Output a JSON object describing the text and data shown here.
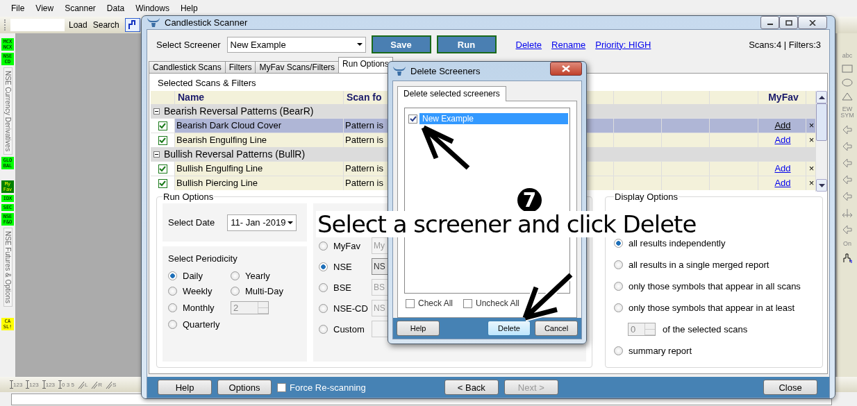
{
  "menu": [
    "File",
    "View",
    "Scanner",
    "Data",
    "Windows",
    "Help"
  ],
  "toolbar": {
    "buttons": [
      "Load",
      "Search"
    ]
  },
  "left_strip": [
    {
      "kind": "tag",
      "lines": [
        "MCX",
        "NCX"
      ],
      "color": "#00ff00"
    },
    {
      "kind": "tag",
      "lines": [
        "NSE",
        "CD"
      ],
      "color": "#00ff00"
    },
    {
      "kind": "vertical",
      "label": "NSE Currency Derivatives"
    },
    {
      "kind": "tag",
      "lines": [
        "GLO",
        "BAL"
      ],
      "color": "#00ff00"
    },
    {
      "kind": "gap"
    },
    {
      "kind": "tag",
      "lines": [
        "My",
        "Fav"
      ],
      "color": "#008000"
    },
    {
      "kind": "tag",
      "lines": [
        "IDX"
      ],
      "color": "#00ff00"
    },
    {
      "kind": "tag",
      "lines": [
        "SEC"
      ],
      "color": "#00ff00"
    },
    {
      "kind": "tag",
      "lines": [
        "NSE",
        "F&O"
      ],
      "color": "#00ff00"
    },
    {
      "kind": "vertical",
      "label": "NSE Futures & Options"
    },
    {
      "kind": "gap"
    },
    {
      "kind": "tag",
      "lines": [
        "CA",
        "SL!"
      ],
      "color": "#ffff00"
    }
  ],
  "bottom_tools": [
    {
      "kind": "measure",
      "label": "123"
    },
    {
      "kind": "measure",
      "label": "123"
    },
    {
      "kind": "measure",
      "label": "123"
    },
    {
      "kind": "measure",
      "label": "0 3 5"
    },
    {
      "kind": "lines",
      "label": "L"
    },
    {
      "kind": "lines",
      "label": "R"
    },
    {
      "kind": "lines",
      "label": "S"
    }
  ],
  "right_strip": [
    {
      "kind": "text",
      "label": "abc"
    },
    {
      "kind": "rect"
    },
    {
      "kind": "ellipse"
    },
    {
      "kind": "triangle"
    },
    {
      "kind": "text",
      "label": "EW SYM"
    },
    {
      "kind": "arrow"
    },
    {
      "kind": "arrow"
    },
    {
      "kind": "arrow"
    },
    {
      "kind": "arrow"
    },
    {
      "kind": "arrow"
    },
    {
      "kind": "timer"
    },
    {
      "kind": "arrow"
    },
    {
      "kind": "text",
      "label": "On"
    },
    {
      "kind": "pen"
    }
  ],
  "scanner": {
    "title": "Candlestick Scanner",
    "select_label": "Select Screener",
    "screener": "New Example",
    "save": "Save",
    "run": "Run",
    "links": [
      "Delete",
      "Rename",
      "Priority: HIGH"
    ],
    "counts": "Scans:4 | Filters:3",
    "tabs": [
      {
        "label": "Candlestick Scans",
        "selected": false
      },
      {
        "label": "Filters",
        "selected": false
      },
      {
        "label": "MyFav Scans/Filters",
        "selected": false
      },
      {
        "label": "Run Options",
        "selected": true
      }
    ],
    "section_title": "Selected Scans & Filters",
    "columns": [
      "Name",
      "Scan fo",
      "MyFav"
    ],
    "rows": [
      {
        "kind": "group",
        "name": "Bearish Reversal Patterns (BearR)"
      },
      {
        "kind": "scan",
        "checked": true,
        "selected": true,
        "name": "Bearish Dark Cloud Cover",
        "scan": "Pattern is",
        "myfav": "Add",
        "remove": "×"
      },
      {
        "kind": "scan",
        "checked": true,
        "selected": false,
        "name": "Bearish Engulfing Line",
        "scan": "Pattern is",
        "myfav": "Add",
        "remove": "×"
      },
      {
        "kind": "group",
        "name": "Bullish Reversal Patterns (BullR)"
      },
      {
        "kind": "scan",
        "checked": true,
        "selected": false,
        "name": "Bullish Engulfing Line",
        "scan": "Pattern is",
        "myfav": "Add",
        "remove": "×"
      },
      {
        "kind": "scan",
        "checked": true,
        "selected": false,
        "name": "Bullish Piercing Line",
        "scan": "Pattern is",
        "myfav": "Add",
        "remove": "×"
      }
    ],
    "run_options": {
      "title": "Run Options",
      "date_label": "Select Date",
      "date": "11- Jan -2019",
      "periodicity_title": "Select Periodicity",
      "periods": [
        {
          "label": "Daily",
          "selected": true
        },
        {
          "label": "Yearly",
          "selected": false
        },
        {
          "label": "Weekly",
          "selected": false
        },
        {
          "label": "Multi-Day",
          "selected": false
        },
        {
          "label": "Monthly",
          "selected": false
        },
        {
          "label": "Quarterly",
          "selected": false
        }
      ],
      "multi_day_value": "2",
      "targets": [
        {
          "label": "MyFav",
          "selected": false,
          "value": "My"
        },
        {
          "label": "NSE",
          "selected": true,
          "value": "NS"
        },
        {
          "label": "BSE",
          "selected": false,
          "value": "BS"
        },
        {
          "label": "NSE-CD",
          "selected": false,
          "value": "NS"
        },
        {
          "label": "Custom",
          "selected": false
        }
      ]
    },
    "display_options": {
      "title": "Display Options",
      "options": [
        {
          "kind": "radio",
          "label": "all results independently",
          "selected": true
        },
        {
          "kind": "radio",
          "label": "all results in a single merged report",
          "selected": false
        },
        {
          "kind": "radio",
          "label": "only those symbols that appear in all scans",
          "selected": false
        },
        {
          "kind": "radio",
          "label": "only those symbols that appear in at least",
          "selected": false
        },
        {
          "kind": "count",
          "value": "0",
          "label": "of the selected scans"
        },
        {
          "kind": "radio",
          "label": "summary report",
          "selected": false
        }
      ]
    },
    "footer": {
      "help": "Help",
      "options": "Options",
      "force": {
        "label": "Force Re-scanning",
        "checked": false
      },
      "back": "< Back",
      "next": {
        "label": "Next >",
        "disabled": true
      },
      "close": "Close"
    }
  },
  "dialog": {
    "title": "Delete Screeners",
    "tab": "Delete selected screeners",
    "items": [
      {
        "label": "New Example",
        "checked": true,
        "selected": true
      }
    ],
    "check_all": {
      "label": "Check All",
      "checked": false
    },
    "uncheck_all": {
      "label": "Uncheck All",
      "checked": false
    },
    "buttons": [
      {
        "label": "Help",
        "default": false
      },
      {
        "label": "Delete",
        "default": true
      },
      {
        "label": "Cancel",
        "default": false
      }
    ]
  },
  "annotation": {
    "step": "7",
    "text": "Select a screener and click Delete"
  }
}
